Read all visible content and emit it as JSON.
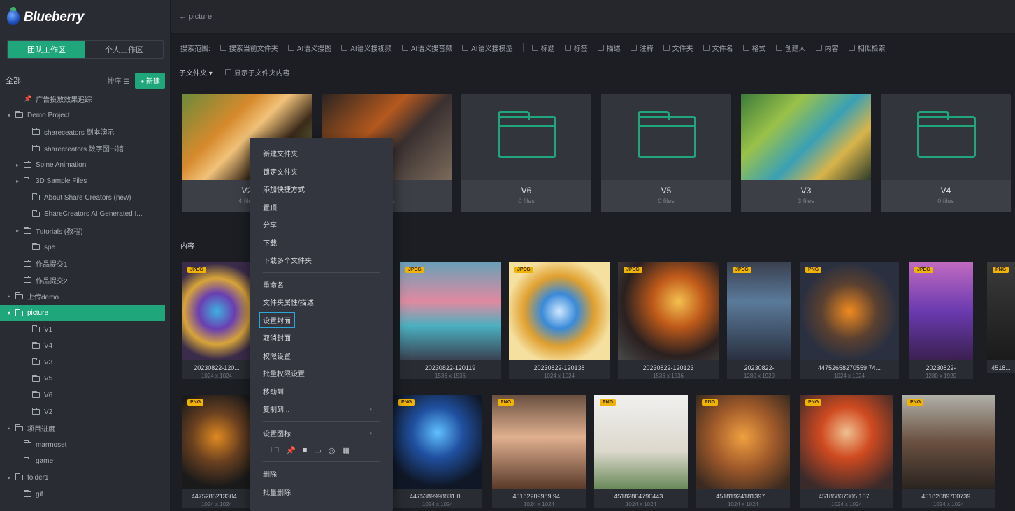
{
  "app": {
    "name": "Blueberry"
  },
  "topbar": {
    "back_label": "← picture"
  },
  "workspace_tabs": [
    "团队工作区",
    "个人工作区"
  ],
  "tree": {
    "all_label": "全部",
    "sort_label": "排序 ☰",
    "new_label": "+ 新建",
    "items": [
      {
        "label": "广告投放效果追踪",
        "indent": 1,
        "caret": "",
        "icon": "pin"
      },
      {
        "label": "Demo Project",
        "indent": 0,
        "caret": "▾",
        "icon": "folder"
      },
      {
        "label": "shareceators 剧本演示",
        "indent": 2,
        "caret": "",
        "icon": "folder"
      },
      {
        "label": "sharecreators 数字图书馆",
        "indent": 2,
        "caret": "",
        "icon": "folder"
      },
      {
        "label": "Spine Animation",
        "indent": 1,
        "caret": "▸",
        "icon": "folder"
      },
      {
        "label": "3D Sample Files",
        "indent": 1,
        "caret": "▸",
        "icon": "folder"
      },
      {
        "label": "About Share Creators (new)",
        "indent": 2,
        "caret": "",
        "icon": "folder"
      },
      {
        "label": "ShareCreators AI Generated I...",
        "indent": 2,
        "caret": "",
        "icon": "folder"
      },
      {
        "label": "Tutorials (教程)",
        "indent": 1,
        "caret": "▸",
        "icon": "folder"
      },
      {
        "label": "spe",
        "indent": 2,
        "caret": "",
        "icon": "folder"
      },
      {
        "label": "作品提交1",
        "indent": 1,
        "caret": "",
        "icon": "folder"
      },
      {
        "label": "作品提交2",
        "indent": 1,
        "caret": "",
        "icon": "folder"
      },
      {
        "label": "上传demo",
        "indent": 0,
        "caret": "▸",
        "icon": "folder"
      },
      {
        "label": "picture",
        "indent": 0,
        "caret": "▾",
        "icon": "folder",
        "selected": true
      },
      {
        "label": "V1",
        "indent": 2,
        "caret": "",
        "icon": "folder"
      },
      {
        "label": "V4",
        "indent": 2,
        "caret": "",
        "icon": "folder"
      },
      {
        "label": "V3",
        "indent": 2,
        "caret": "",
        "icon": "folder"
      },
      {
        "label": "V5",
        "indent": 2,
        "caret": "",
        "icon": "folder"
      },
      {
        "label": "V6",
        "indent": 2,
        "caret": "",
        "icon": "folder"
      },
      {
        "label": "V2",
        "indent": 2,
        "caret": "",
        "icon": "folder"
      },
      {
        "label": "项目进度",
        "indent": 0,
        "caret": "▸",
        "icon": "folder"
      },
      {
        "label": "marmoset",
        "indent": 1,
        "caret": "",
        "icon": "folder"
      },
      {
        "label": "game",
        "indent": 1,
        "caret": "",
        "icon": "folder"
      },
      {
        "label": "folder1",
        "indent": 0,
        "caret": "▸",
        "icon": "folder"
      },
      {
        "label": "gif",
        "indent": 1,
        "caret": "",
        "icon": "folder"
      }
    ]
  },
  "filterbar": {
    "label": "搜索范围:",
    "group1": [
      "搜索当前文件夹",
      "AI语义搜图",
      "AI语义搜视频",
      "AI语义搜音频",
      "AI语义搜模型"
    ],
    "group2": [
      "标题",
      "标签",
      "描述",
      "注释",
      "文件夹",
      "文件名",
      "格式",
      "创建人",
      "内容",
      "相似检索"
    ]
  },
  "subbar": {
    "subfolder_label": "子文件夹 ▾",
    "show_sub_label": "显示子文件夹内容"
  },
  "folders": [
    {
      "name": "V2",
      "count": "4 files",
      "thumb": "tiger"
    },
    {
      "name": "V",
      "count": "4 files",
      "thumb": "mixed"
    },
    {
      "name": "V6",
      "count": "0 files",
      "thumb": "empty"
    },
    {
      "name": "V5",
      "count": "0 files",
      "thumb": "empty"
    },
    {
      "name": "V3",
      "count": "3 files",
      "thumb": "anime"
    },
    {
      "name": "V4",
      "count": "0 files",
      "thumb": "empty"
    }
  ],
  "content_title": "内容",
  "images_row1": [
    {
      "badge": "JPEG",
      "name": "20230822-120...",
      "dims": "1024 x 1024",
      "theme": "shield-purple"
    },
    {
      "badge": "JPEG",
      "name": "20230822-120119",
      "dims": "1536 x 1536",
      "theme": "girl"
    },
    {
      "badge": "JPEG",
      "name": "20230822-120138",
      "dims": "1024 x 1024",
      "theme": "shield-gold"
    },
    {
      "badge": "JPEG",
      "name": "20230822-120123",
      "dims": "1536 x 1536",
      "theme": "horse"
    },
    {
      "badge": "JPEG",
      "name": "20230822-",
      "dims": "1280 x 1920",
      "theme": "robot-blue"
    },
    {
      "badge": "PNG",
      "name": "44752658270559 74...",
      "dims": "1024 x 1024",
      "theme": "cube"
    },
    {
      "badge": "JPEG",
      "name": "20230822-",
      "dims": "1280 x 1920",
      "theme": "mech-purple"
    },
    {
      "badge": "PNG",
      "name": "4518...",
      "dims": "",
      "theme": "dark"
    }
  ],
  "images_row2": [
    {
      "badge": "PNG",
      "name": "4475285213304...",
      "dims": "1024 x 1024",
      "theme": "robot-orange"
    },
    {
      "badge": "PNG",
      "name": "4475389998831 0...",
      "dims": "1024 x 1024",
      "theme": "robot-blue2"
    },
    {
      "badge": "PNG",
      "name": "45182209989 94...",
      "dims": "1024 x 1024",
      "theme": "girl-cap"
    },
    {
      "badge": "PNG",
      "name": "45182864790443...",
      "dims": "1024 x 1024",
      "theme": "plane"
    },
    {
      "badge": "PNG",
      "name": "45181924181397...",
      "dims": "1024 x 1024",
      "theme": "hamster"
    },
    {
      "badge": "PNG",
      "name": "45185837305 107...",
      "dims": "1024 x 1024",
      "theme": "girl-red"
    },
    {
      "badge": "PNG",
      "name": "45182089700739...",
      "dims": "1024 x 1024",
      "theme": "pilot"
    }
  ],
  "context_menu": {
    "group1": [
      "新建文件夹",
      "锁定文件夹",
      "添加快捷方式",
      "置顶",
      "分享",
      "下载",
      "下载多个文件夹"
    ],
    "group2": [
      "重命名",
      "文件夹属性/描述",
      "设置封面",
      "取消封面",
      "权限设置",
      "批量权限设置",
      "移动到",
      "复制到..."
    ],
    "highlight": "设置封面",
    "has_submenu": [
      "复制到..."
    ],
    "group3_label": "设置图标",
    "icon_glyphs": [
      "🗀",
      "📌",
      "■",
      "▭",
      "◎",
      "▦"
    ],
    "group4": [
      "删除",
      "批量删除"
    ]
  }
}
